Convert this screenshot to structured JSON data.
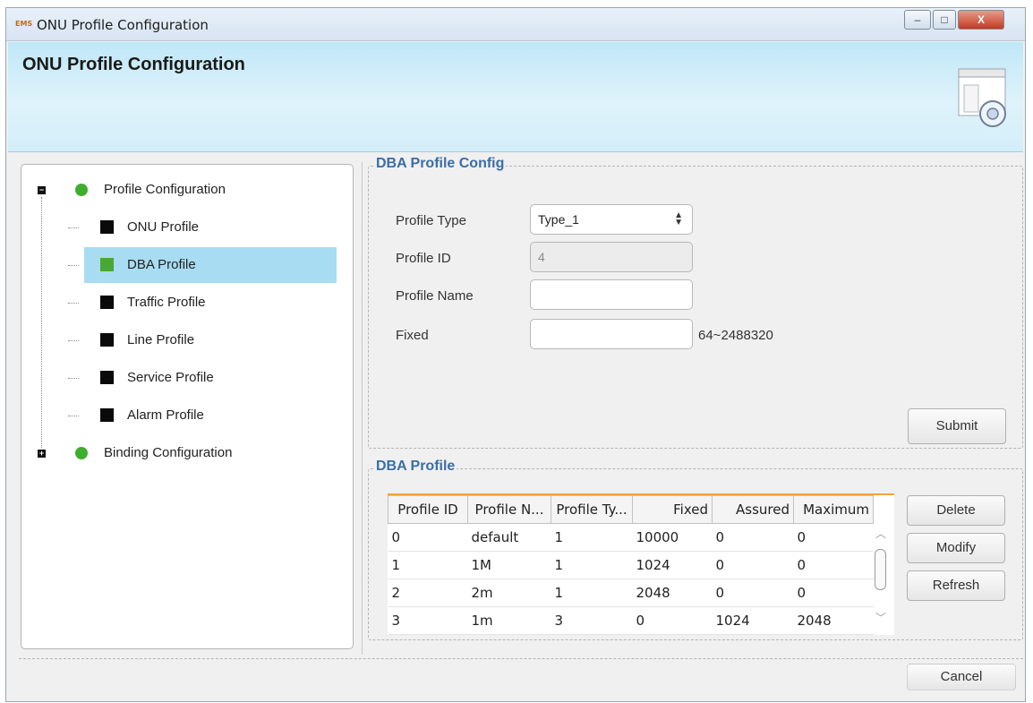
{
  "window": {
    "app_icon_text": "EMS",
    "title": "ONU Profile Configuration",
    "minimize_label": "–",
    "maximize_label": "□",
    "close_label": "X"
  },
  "header": {
    "title": "ONU Profile Configuration",
    "icon": "settings-window-icon"
  },
  "tree": {
    "root": {
      "label": "Profile Configuration",
      "expanded": true,
      "icon": "green-chevron-down-icon"
    },
    "children": [
      {
        "label": "ONU Profile",
        "selected": false
      },
      {
        "label": "DBA Profile",
        "selected": true
      },
      {
        "label": "Traffic Profile",
        "selected": false
      },
      {
        "label": "Line Profile",
        "selected": false
      },
      {
        "label": "Service Profile",
        "selected": false
      },
      {
        "label": "Alarm Profile",
        "selected": false
      }
    ],
    "second_root": {
      "label": "Binding Configuration",
      "expanded": false,
      "icon": "green-play-icon"
    }
  },
  "config_form": {
    "legend": "DBA Profile Config",
    "profile_type_label": "Profile Type",
    "profile_type_value": "Type_1",
    "profile_id_label": "Profile ID",
    "profile_id_value": "4",
    "profile_name_label": "Profile Name",
    "profile_name_value": "",
    "fixed_label": "Fixed",
    "fixed_value": "",
    "fixed_range": "64~2488320",
    "submit_label": "Submit"
  },
  "dba_table": {
    "legend": "DBA Profile",
    "columns": [
      "Profile ID",
      "Profile N...",
      "Profile Ty...",
      "Fixed",
      "Assured",
      "Maximum"
    ],
    "rows": [
      [
        "0",
        "default",
        "1",
        "10000",
        "0",
        "0"
      ],
      [
        "1",
        "1M",
        "1",
        "1024",
        "0",
        "0"
      ],
      [
        "2",
        "2m",
        "1",
        "2048",
        "0",
        "0"
      ],
      [
        "3",
        "1m",
        "3",
        "0",
        "1024",
        "2048"
      ]
    ],
    "delete_label": "Delete",
    "modify_label": "Modify",
    "refresh_label": "Refresh"
  },
  "footer": {
    "cancel_label": "Cancel"
  },
  "colors": {
    "legend_text": "#3a6ea5",
    "selection": "#a8dcf2",
    "tree_green": "#3fae2e",
    "table_top_border": "#f0a53b"
  }
}
